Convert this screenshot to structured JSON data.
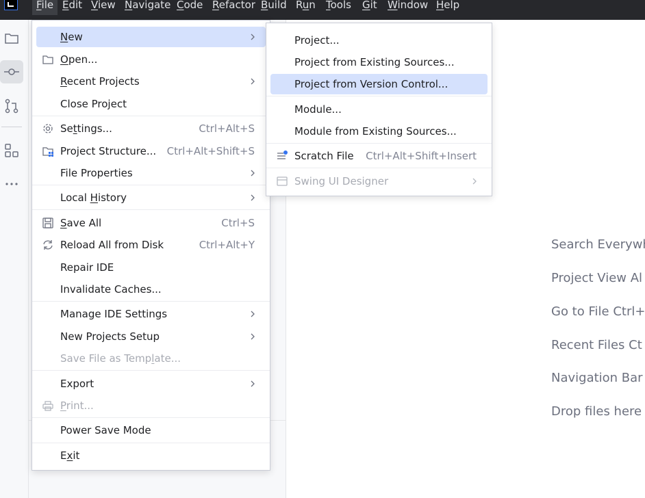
{
  "menubar": {
    "items": [
      {
        "label": "File",
        "ul": "F",
        "rest": "ile",
        "active": true
      },
      {
        "label": "Edit",
        "ul": "E",
        "rest": "dit"
      },
      {
        "label": "View",
        "ul": "V",
        "rest": "iew"
      },
      {
        "label": "Navigate",
        "ul": "N",
        "rest": "avigate"
      },
      {
        "label": "Code",
        "ul": "C",
        "rest": "ode"
      },
      {
        "label": "Refactor",
        "ul": "R",
        "rest": "efactor"
      },
      {
        "label": "Build",
        "ul": "B",
        "rest": "uild"
      },
      {
        "label": "Run",
        "pre": "R",
        "ul": "u",
        "rest": "n"
      },
      {
        "label": "Tools",
        "ul": "T",
        "rest": "ools"
      },
      {
        "label": "Git",
        "ul": "G",
        "rest": "it"
      },
      {
        "label": "Window",
        "ul": "W",
        "rest": "indow"
      },
      {
        "label": "Help",
        "ul": "H",
        "rest": "elp"
      }
    ]
  },
  "toolstrip": {
    "icons": [
      "folder-icon",
      "commit-icon",
      "pull-requests-icon",
      "structure-icon",
      "more-icon"
    ]
  },
  "file_menu": {
    "items": [
      {
        "pre": "",
        "ul": "N",
        "rest": "ew",
        "shortcut": "",
        "submenu": true,
        "highlighted": true
      },
      {
        "pre": "",
        "ul": "O",
        "rest": "pen...",
        "shortcut": "",
        "icon": "folder-icon"
      },
      {
        "pre": "",
        "ul": "R",
        "rest": "ecent Projects",
        "shortcut": "",
        "submenu": true
      },
      {
        "pre": "Close Project",
        "ul": "",
        "rest": "",
        "shortcut": ""
      },
      {
        "pre": "Se",
        "ul": "t",
        "rest": "tings...",
        "shortcut": "Ctrl+Alt+S",
        "icon": "gear-icon"
      },
      {
        "pre": "Project Structure...",
        "ul": "",
        "rest": "",
        "shortcut": "Ctrl+Alt+Shift+S",
        "icon": "project-structure-icon"
      },
      {
        "pre": "File Properties",
        "ul": "",
        "rest": "",
        "shortcut": "",
        "submenu": true
      },
      {
        "pre": "Local ",
        "ul": "H",
        "rest": "istory",
        "shortcut": "",
        "submenu": true
      },
      {
        "pre": "",
        "ul": "S",
        "rest": "ave All",
        "shortcut": "Ctrl+S",
        "icon": "save-icon"
      },
      {
        "pre": "Reload All from Disk",
        "ul": "",
        "rest": "",
        "shortcut": "Ctrl+Alt+Y",
        "icon": "reload-icon"
      },
      {
        "pre": "Repair IDE",
        "ul": "",
        "rest": "",
        "shortcut": ""
      },
      {
        "pre": "Invalidate Caches...",
        "ul": "",
        "rest": "",
        "shortcut": ""
      },
      {
        "pre": "Manage IDE Settings",
        "ul": "",
        "rest": "",
        "shortcut": "",
        "submenu": true
      },
      {
        "pre": "New Projects Setup",
        "ul": "",
        "rest": "",
        "shortcut": "",
        "submenu": true
      },
      {
        "pre": "Save File as Temp",
        "ul": "l",
        "rest": "ate...",
        "shortcut": "",
        "disabled": true
      },
      {
        "pre": "Export",
        "ul": "",
        "rest": "",
        "shortcut": "",
        "submenu": true
      },
      {
        "pre": "",
        "ul": "P",
        "rest": "rint...",
        "shortcut": "",
        "disabled": true,
        "icon": "print-icon"
      },
      {
        "pre": "Power Save Mode",
        "ul": "",
        "rest": "",
        "shortcut": ""
      },
      {
        "pre": "E",
        "ul": "x",
        "rest": "it",
        "shortcut": ""
      }
    ]
  },
  "new_menu": {
    "items": [
      {
        "label": "Project...",
        "shortcut": ""
      },
      {
        "label": "Project from Existing Sources...",
        "shortcut": ""
      },
      {
        "label": "Project from Version Control...",
        "shortcut": "",
        "highlighted": true
      },
      {
        "label": "Module...",
        "shortcut": ""
      },
      {
        "label": "Module from Existing Sources...",
        "shortcut": ""
      },
      {
        "label": "Scratch File",
        "shortcut": "Ctrl+Alt+Shift+Insert",
        "icon": "scratch-file-icon"
      },
      {
        "label": "Swing UI Designer",
        "shortcut": "",
        "submenu": true,
        "disabled": true,
        "icon": "form-icon"
      }
    ]
  },
  "editor_hints": [
    "Search Everywh",
    "Project View Al",
    "Go to File Ctrl+",
    "Recent Files Ct",
    "Navigation Bar",
    "Drop files here"
  ],
  "colors": {
    "menubar_bg": "#27282c",
    "highlight": "#d5e1fd",
    "accent": "#3574f0"
  }
}
